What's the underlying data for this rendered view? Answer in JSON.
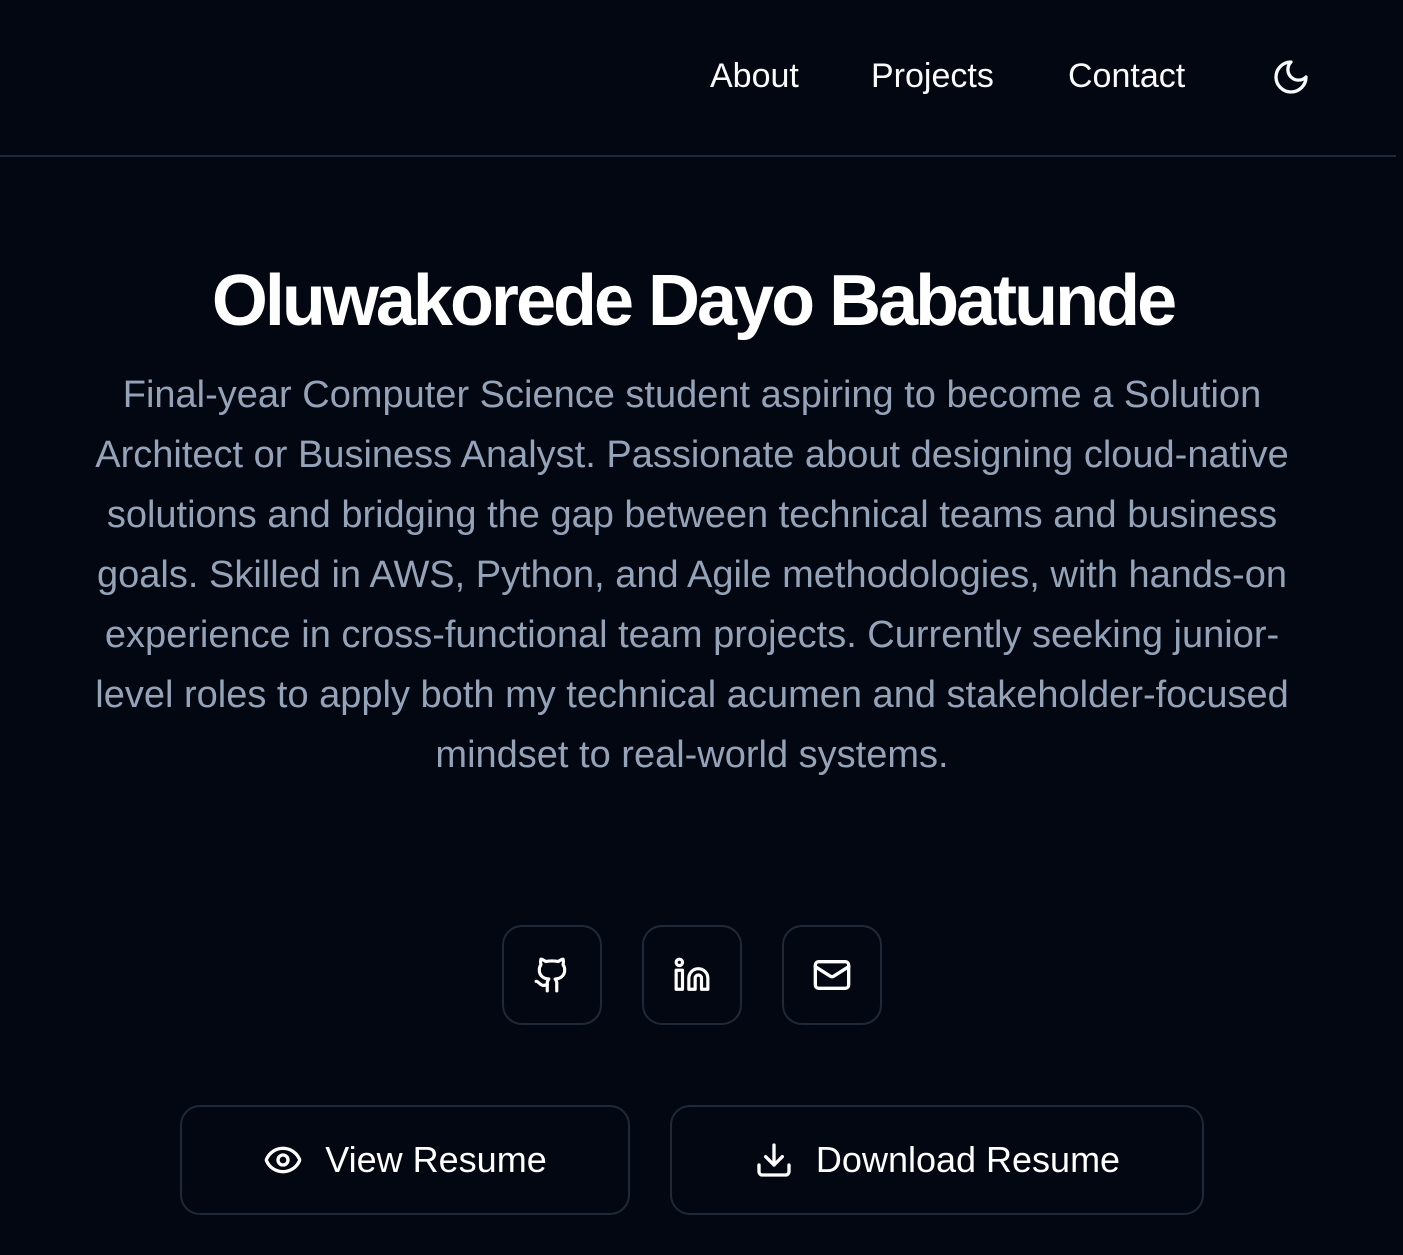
{
  "nav": {
    "items": [
      {
        "label": "About"
      },
      {
        "label": "Projects"
      },
      {
        "label": "Contact"
      }
    ],
    "theme_toggle_icon": "moon-icon"
  },
  "hero": {
    "name": "Oluwakorede Dayo Babatunde",
    "bio": "Final-year Computer Science student aspiring to become a Solution Architect or Business Analyst. Passionate about designing cloud-native solutions and bridging the gap between technical teams and business goals. Skilled in AWS, Python, and Agile methodologies, with hands-on experience in cross-functional team projects. Currently seeking junior-level roles to apply both my technical acumen and stakeholder-focused mindset to real-world systems."
  },
  "social": [
    {
      "icon": "github-icon"
    },
    {
      "icon": "linkedin-icon"
    },
    {
      "icon": "mail-icon"
    }
  ],
  "actions": {
    "view_resume": {
      "label": "View Resume",
      "icon": "eye-icon"
    },
    "download_resume": {
      "label": "Download Resume",
      "icon": "download-icon"
    }
  },
  "colors": {
    "background": "#030712",
    "heading": "#ffffff",
    "body_text": "#94a3b8",
    "border": "#1f2937"
  }
}
